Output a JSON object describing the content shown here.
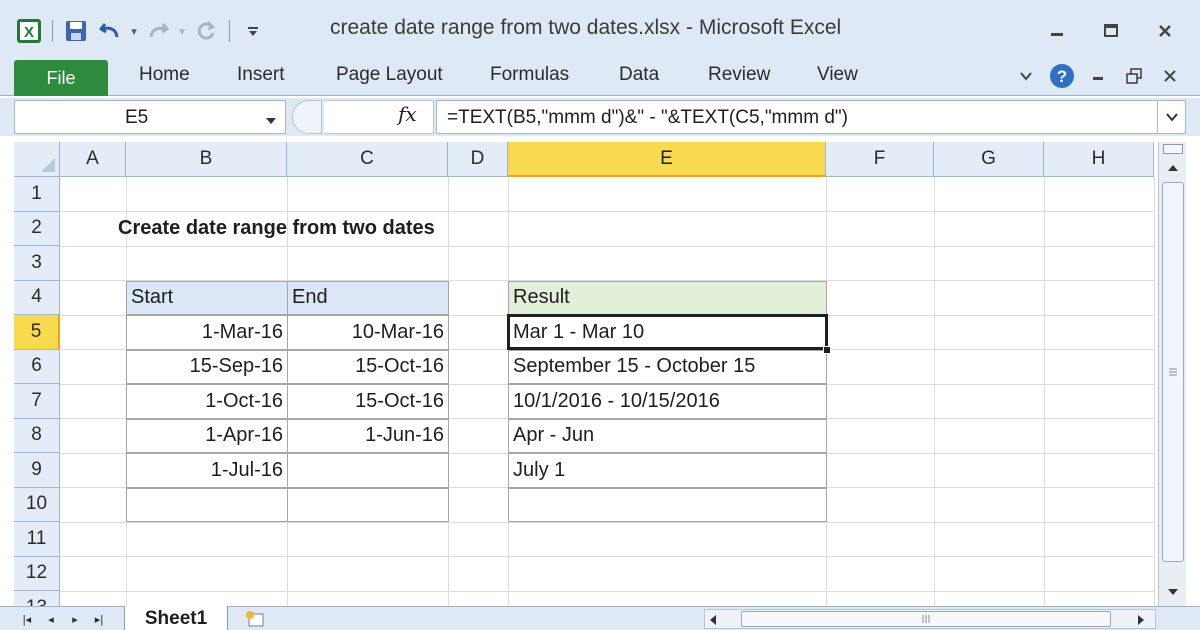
{
  "app": {
    "window_title": "create date range from two dates.xlsx  -  Microsoft Excel"
  },
  "quick_access": {
    "icons": [
      "excel-logo-icon",
      "save-icon",
      "undo-icon",
      "redo-icon",
      "refresh-icon",
      "customize-dropdown-icon"
    ]
  },
  "ribbon": {
    "file": "File",
    "tabs": [
      "Home",
      "Insert",
      "Page Layout",
      "Formulas",
      "Data",
      "Review",
      "View"
    ]
  },
  "formula_bar": {
    "name_box": "E5",
    "fx_label": "fx",
    "formula": "=TEXT(B5,\"mmm d\")&\" - \"&TEXT(C5,\"mmm d\")"
  },
  "columns": [
    "A",
    "B",
    "C",
    "D",
    "E",
    "F",
    "G",
    "H"
  ],
  "rows": [
    "1",
    "2",
    "3",
    "4",
    "5",
    "6",
    "7",
    "8",
    "9",
    "10",
    "11",
    "12",
    "13"
  ],
  "selected": {
    "column": "E",
    "row": "5"
  },
  "sheet": {
    "title": "Create date range from two dates",
    "table": {
      "headers": [
        "Start",
        "End"
      ],
      "rows": [
        [
          "1-Mar-16",
          "10-Mar-16"
        ],
        [
          "15-Sep-16",
          "15-Oct-16"
        ],
        [
          "1-Oct-16",
          "15-Oct-16"
        ],
        [
          "1-Apr-16",
          "1-Jun-16"
        ],
        [
          "1-Jul-16",
          ""
        ],
        [
          "",
          ""
        ]
      ]
    },
    "result": {
      "header": "Result",
      "rows": [
        "Mar 1 - Mar 10",
        "September 15 - October 15",
        "10/1/2016 - 10/15/2016",
        "Apr - Jun",
        "July 1",
        ""
      ]
    }
  },
  "sheet_tabs": {
    "active": "Sheet1"
  },
  "colors": {
    "accent_file_tab": "#2e8a3c",
    "selected_header": "#f9d94e",
    "table_header_blue": "#dbe7f5",
    "result_header_green": "#e2efda"
  }
}
